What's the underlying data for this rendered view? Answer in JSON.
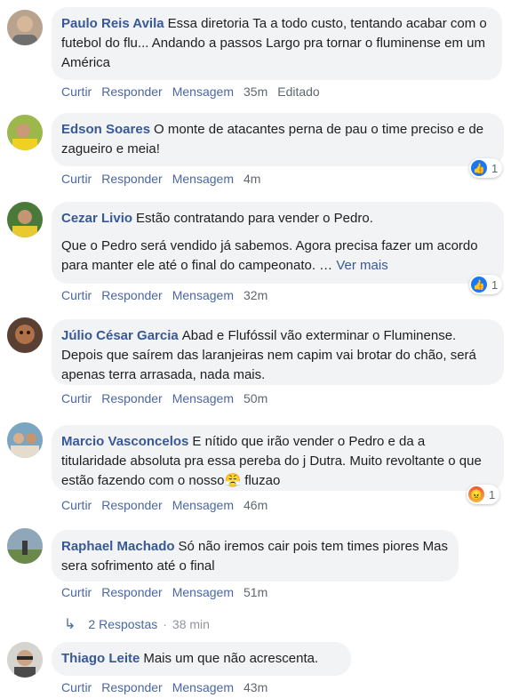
{
  "actions": {
    "like": "Curtir",
    "reply": "Responder",
    "message": "Mensagem"
  },
  "comments": [
    {
      "author": "Paulo Reis Avila",
      "text": "Essa diretoria Ta a todo custo, tentando acabar com o futebol do flu... Andando a passos Largo pra tornar o fluminense em um América",
      "time": "35m",
      "edited": "Editado"
    },
    {
      "author": "Edson Soares",
      "text": "O monte de atacantes perna de pau o time preciso e de zagueiro e meia!",
      "time": "4m",
      "reaction": {
        "type": "like-icon",
        "count": "1"
      }
    },
    {
      "author": "Cezar Livio",
      "text": "Estão contratando para vender o Pedro.",
      "text2": "Que o Pedro será vendido já sabemos. Agora precisa fazer um acordo para manter ele até o final do campeonato. …",
      "see_more": "Ver mais",
      "time": "32m",
      "reaction": {
        "type": "like-icon",
        "count": "1"
      }
    },
    {
      "author": "Júlio César Garcia",
      "text": "Abad e Flufóssil vão exterminar o Fluminense. Depois que saírem das laranjeiras nem capim vai brotar do chão, será apenas terra arrasada, nada mais.",
      "time": "50m"
    },
    {
      "author": "Marcio Vasconcelos",
      "text": "E nítido que irão vender o Pedro e da a titularidade absoluta pra essa pereba do j Dutra. Muito revoltante o que estão fazendo com o nosso",
      "emoji": "😤",
      "text_end": " fluzao",
      "time": "46m",
      "reaction": {
        "type": "angry-icon",
        "count": "1"
      }
    },
    {
      "author": "Raphael Machado",
      "text": "Só não iremos cair pois tem times piores Mas sera sofrimento até o final",
      "time": "51m"
    },
    {
      "author": "Thiago Leite",
      "text": "Mais um que não acrescenta.",
      "time": "43m"
    }
  ],
  "replies": {
    "label": "2 Respostas",
    "separator": "·",
    "time": "38 min"
  },
  "colors": {
    "author": "#385898",
    "bubble": "#f2f3f5",
    "action": "#4b67a1",
    "meta": "#606770",
    "like": "#1877f2"
  }
}
